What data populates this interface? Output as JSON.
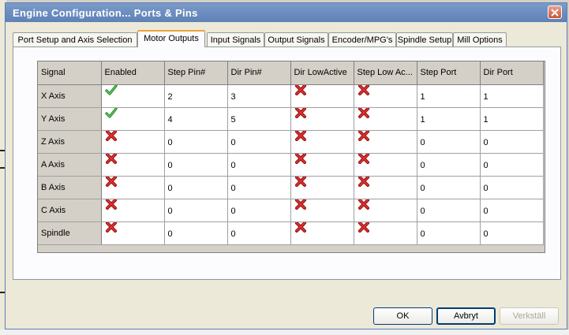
{
  "window": {
    "title": "Engine Configuration... Ports & Pins"
  },
  "tabs": [
    {
      "label": "Port Setup and Axis Selection",
      "active": false
    },
    {
      "label": "Motor Outputs",
      "active": true
    },
    {
      "label": "Input Signals",
      "active": false
    },
    {
      "label": "Output Signals",
      "active": false
    },
    {
      "label": "Encoder/MPG's",
      "active": false
    },
    {
      "label": "Spindle Setup",
      "active": false
    },
    {
      "label": "Mill Options",
      "active": false
    }
  ],
  "grid": {
    "columns": [
      "Signal",
      "Enabled",
      "Step Pin#",
      "Dir Pin#",
      "Dir LowActive",
      "Step Low Ac...",
      "Step Port",
      "Dir Port"
    ],
    "rows": [
      {
        "signal": "X Axis",
        "enabled": "check-icon",
        "step_pin": "2",
        "dir_pin": "3",
        "dir_low_active": "x-icon",
        "step_low_active": "x-icon",
        "step_port": "1",
        "dir_port": "1"
      },
      {
        "signal": "Y Axis",
        "enabled": "check-icon",
        "step_pin": "4",
        "dir_pin": "5",
        "dir_low_active": "x-icon",
        "step_low_active": "x-icon",
        "step_port": "1",
        "dir_port": "1"
      },
      {
        "signal": "Z Axis",
        "enabled": "x-icon",
        "step_pin": "0",
        "dir_pin": "0",
        "dir_low_active": "x-icon",
        "step_low_active": "x-icon",
        "step_port": "0",
        "dir_port": "0"
      },
      {
        "signal": "A Axis",
        "enabled": "x-icon",
        "step_pin": "0",
        "dir_pin": "0",
        "dir_low_active": "x-icon",
        "step_low_active": "x-icon",
        "step_port": "0",
        "dir_port": "0"
      },
      {
        "signal": "B Axis",
        "enabled": "x-icon",
        "step_pin": "0",
        "dir_pin": "0",
        "dir_low_active": "x-icon",
        "step_low_active": "x-icon",
        "step_port": "0",
        "dir_port": "0"
      },
      {
        "signal": "C Axis",
        "enabled": "x-icon",
        "step_pin": "0",
        "dir_pin": "0",
        "dir_low_active": "x-icon",
        "step_low_active": "x-icon",
        "step_port": "0",
        "dir_port": "0"
      },
      {
        "signal": "Spindle",
        "enabled": "x-icon",
        "step_pin": "0",
        "dir_pin": "0",
        "dir_low_active": "x-icon",
        "step_low_active": "x-icon",
        "step_port": "0",
        "dir_port": "0"
      }
    ]
  },
  "buttons": {
    "ok": "OK",
    "cancel": "Avbryt",
    "apply": "Verkställ"
  },
  "colors": {
    "titlebar": "#6d8fc0",
    "active_tab_accent": "#f0a23c",
    "check": "#2eaa2e",
    "cross": "#cc1f1f"
  }
}
